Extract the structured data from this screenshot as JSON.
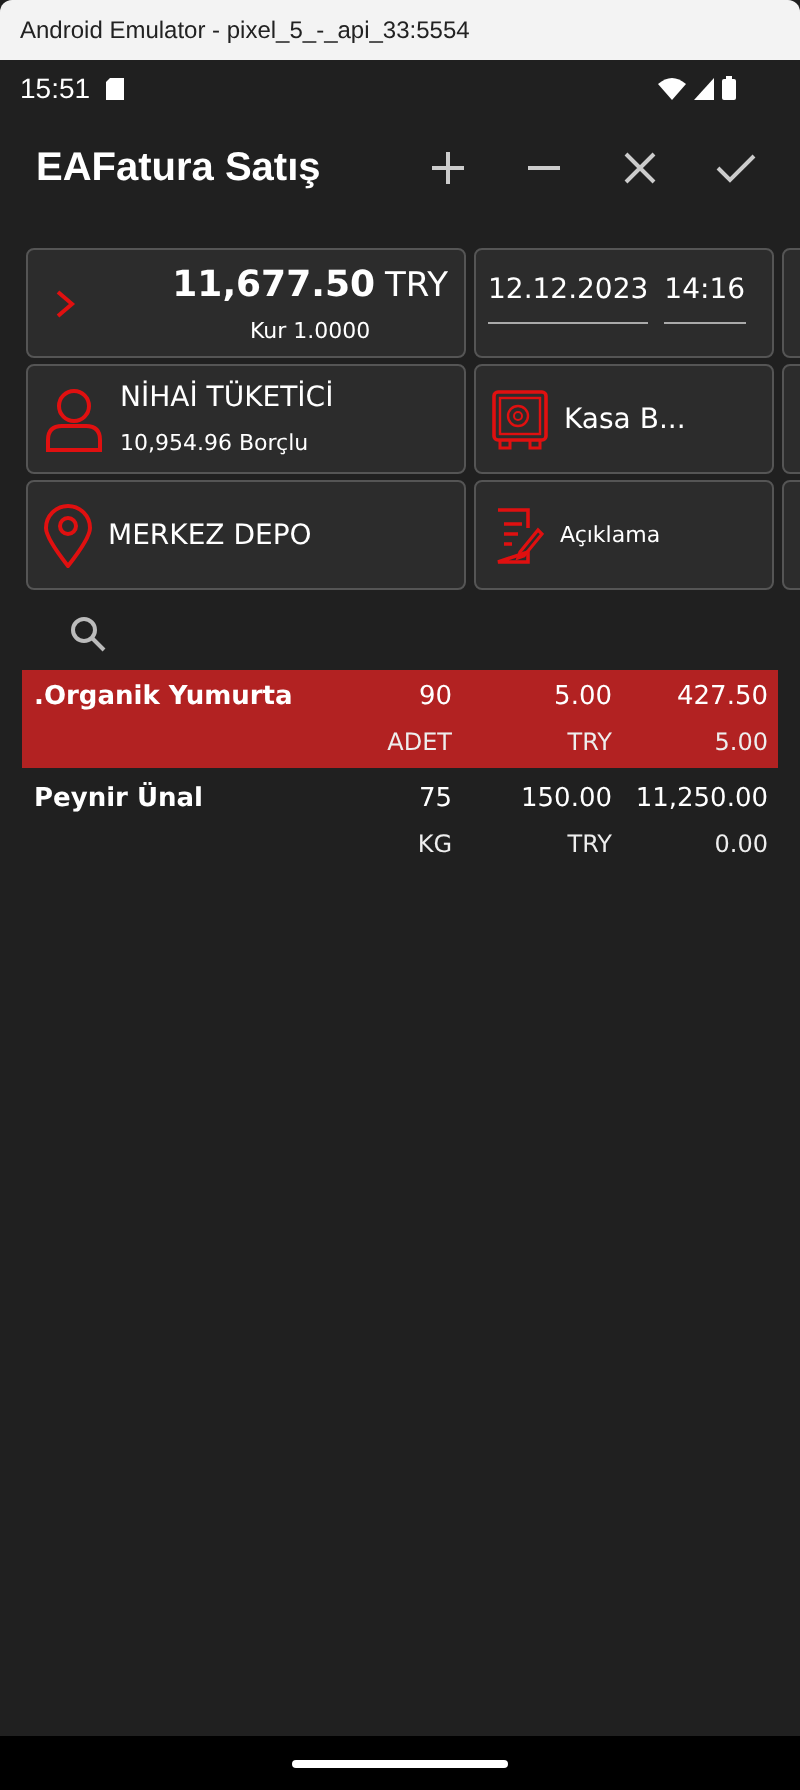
{
  "window": {
    "title": "Android Emulator - pixel_5_-_api_33:5554"
  },
  "status_bar": {
    "time": "15:51"
  },
  "app_bar": {
    "title": "EAFatura Satış"
  },
  "total_card": {
    "amount": "11,677.50",
    "currency": "TRY",
    "rate": "Kur 1.0000"
  },
  "date_card": {
    "date": "12.12.2023",
    "time": "14:16"
  },
  "customer_card": {
    "name": "NİHAİ TÜKETİCİ",
    "balance": "10,954.96 Borçlu"
  },
  "cash_card": {
    "label": "Kasa B..."
  },
  "warehouse_card": {
    "label": "MERKEZ DEPO"
  },
  "note_card": {
    "label": "Açıklama"
  },
  "items": [
    {
      "name": ".Organik Yumurta",
      "quantity": "90",
      "price": "5.00",
      "total": "427.50",
      "unit": "ADET",
      "currency": "TRY",
      "discount": "5.00",
      "selected": true
    },
    {
      "name": "Peynir Ünal",
      "quantity": "75",
      "price": "150.00",
      "total": "11,250.00",
      "unit": "KG",
      "currency": "TRY",
      "discount": "0.00",
      "selected": false
    }
  ]
}
